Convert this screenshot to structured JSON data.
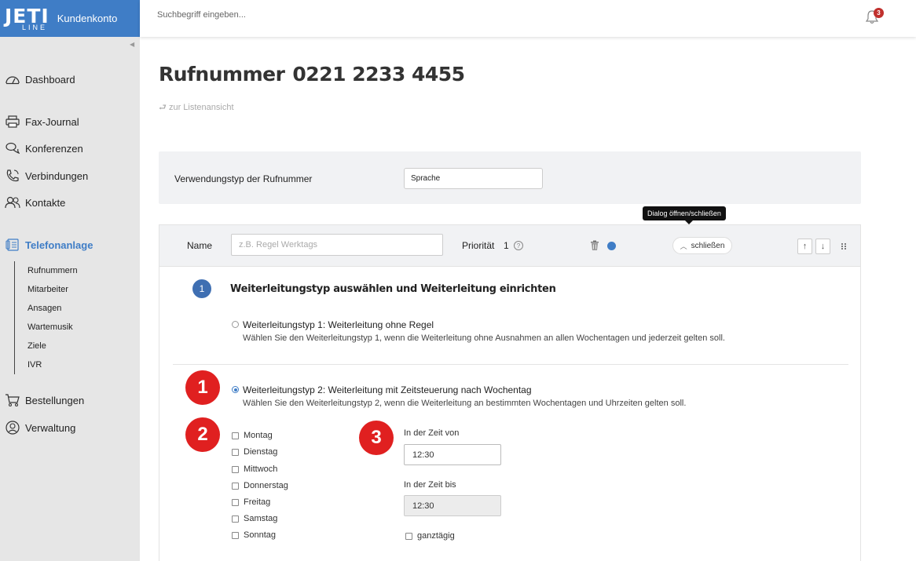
{
  "brand": {
    "logo_main": "JETI",
    "logo_sub": "LINE",
    "label": "Kundenkonto"
  },
  "topbar": {
    "search_placeholder": "Suchbegriff eingeben...",
    "notification_count": "3"
  },
  "sidebar": {
    "items": [
      {
        "label": "Dashboard",
        "icon": "dashboard-icon"
      },
      {
        "label": "Fax-Journal",
        "icon": "printer-icon"
      },
      {
        "label": "Konferenzen",
        "icon": "chat-icon"
      },
      {
        "label": "Verbindungen",
        "icon": "phone-icon"
      },
      {
        "label": "Kontakte",
        "icon": "contacts-icon"
      },
      {
        "label": "Telefonanlage",
        "icon": "pbx-icon",
        "active": true
      },
      {
        "label": "Bestellungen",
        "icon": "cart-icon"
      },
      {
        "label": "Verwaltung",
        "icon": "user-circle-icon"
      }
    ],
    "subitems": [
      "Rufnummern",
      "Mitarbeiter",
      "Ansagen",
      "Wartemusik",
      "Ziele",
      "IVR"
    ]
  },
  "page": {
    "title": "Rufnummer",
    "number": "0221 2233 4455",
    "back_link": "zur Listenansicht"
  },
  "usage": {
    "label": "Verwendungstyp der Rufnummer",
    "value": "Sprache"
  },
  "tooltip": "Dialog öffnen/schließen",
  "rule": {
    "name_label": "Name",
    "name_placeholder": "z.B. Regel Werktags",
    "priority_label": "Priorität",
    "priority_value": "1",
    "help": "?",
    "close_label": "schließen",
    "up": "↑",
    "down": "↓",
    "accent": "#3f7dc6"
  },
  "step": {
    "number": "1",
    "title": "Weiterleitungstyp auswählen und Weiterleitung einrichten",
    "options": [
      {
        "title": "Weiterleitungstyp 1: Weiterleitung ohne Regel",
        "desc": "Wählen Sie den Weiterleitungstyp 1, wenn die Weiterleitung ohne Ausnahmen an allen Wochentagen und jederzeit gelten soll.",
        "checked": false
      },
      {
        "title": "Weiterleitungstyp 2: Weiterleitung mit Zeitsteuerung nach Wochentag",
        "desc": "Wählen Sie den Weiterleitungstyp 2, wenn die Weiterleitung an bestimmten Wochentagen und Uhrzeiten gelten soll.",
        "checked": true
      }
    ]
  },
  "annotations": [
    "1",
    "2",
    "3"
  ],
  "days": [
    "Montag",
    "Dienstag",
    "Mittwoch",
    "Donnerstag",
    "Freitag",
    "Samstag",
    "Sonntag"
  ],
  "time": {
    "from_label": "In der Zeit von",
    "from_value": "12:30",
    "to_label": "In der Zeit bis",
    "to_value": "12:30",
    "allday_label": "ganztägig"
  }
}
